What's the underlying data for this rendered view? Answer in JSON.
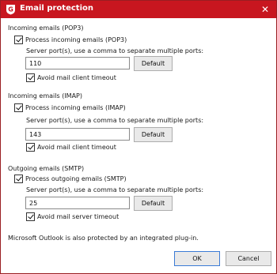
{
  "window": {
    "title": "Email protection",
    "close_glyph": "✕"
  },
  "pop3": {
    "section_title": "Incoming emails (POP3)",
    "process_label": "Process incoming emails (POP3)",
    "ports_hint": "Server port(s), use a comma to separate multiple ports:",
    "port_value": "110",
    "default_label": "Default",
    "timeout_label": "Avoid mail client timeout"
  },
  "imap": {
    "section_title": "Incoming emails (IMAP)",
    "process_label": "Process incoming emails (IMAP)",
    "ports_hint": "Server port(s), use a comma to separate multiple ports:",
    "port_value": "143",
    "default_label": "Default",
    "timeout_label": "Avoid mail client timeout"
  },
  "smtp": {
    "section_title": "Outgoing emails (SMTP)",
    "process_label": "Process outgoing emails (SMTP)",
    "ports_hint": "Server port(s), use a comma to separate multiple ports:",
    "port_value": "25",
    "default_label": "Default",
    "timeout_label": "Avoid mail server timeout"
  },
  "footer": {
    "note": "Microsoft Outlook is also protected by an integrated plug-in.",
    "ok_label": "OK",
    "cancel_label": "Cancel"
  },
  "colors": {
    "titlebar": "#c8161f",
    "focus_border": "#3b7bd6"
  },
  "icons": {
    "app": "gdata-shield-icon",
    "close": "close-icon",
    "check": "checkmark-icon"
  }
}
